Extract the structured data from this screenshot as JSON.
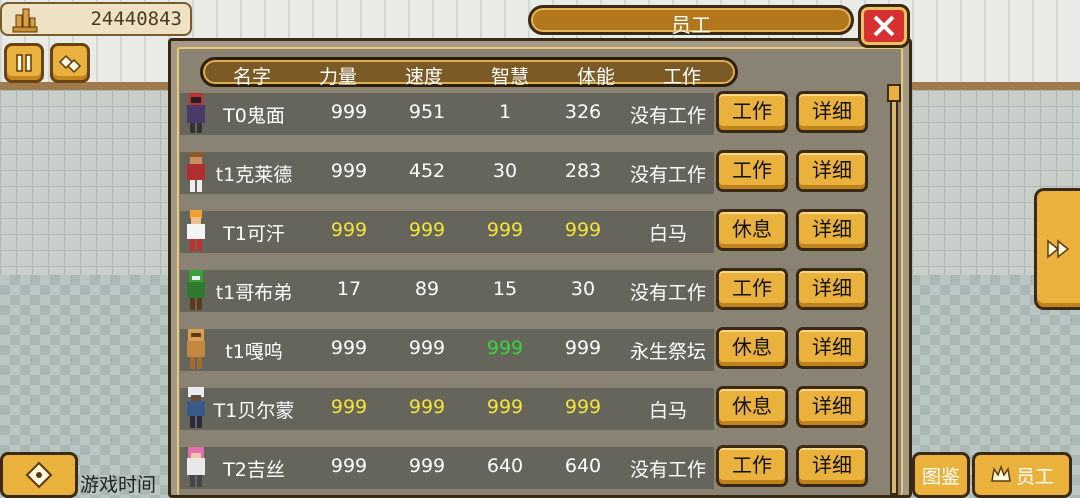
{
  "resource": {
    "amount": "24440843",
    "icon": "building-icon"
  },
  "top_buttons": [
    {
      "icon": "pause-icon"
    },
    {
      "icon": "gems-icon"
    }
  ],
  "panel": {
    "title": "员工",
    "close_icon": "close-icon"
  },
  "columns": [
    "名字",
    "力量",
    "速度",
    "智慧",
    "体能",
    "工作"
  ],
  "employees": [
    {
      "name": "T0鬼面",
      "str": "999",
      "spd": "951",
      "int": "1",
      "sta": "326",
      "job": "没有工作",
      "action": "工作",
      "detail": "详细"
    },
    {
      "name": "t1克莱德",
      "str": "999",
      "spd": "452",
      "int": "30",
      "sta": "283",
      "job": "没有工作",
      "action": "工作",
      "detail": "详细"
    },
    {
      "name": "T1可汗",
      "str": "999",
      "spd": "999",
      "int": "999",
      "sta": "999",
      "job": "白马",
      "action": "休息",
      "detail": "详细"
    },
    {
      "name": "t1哥布弟",
      "str": "17",
      "spd": "89",
      "int": "15",
      "sta": "30",
      "job": "没有工作",
      "action": "工作",
      "detail": "详细"
    },
    {
      "name": "t1嘎呜",
      "str": "999",
      "spd": "999",
      "int": "999",
      "sta": "999",
      "job": "永生祭坛",
      "action": "休息",
      "detail": "详细"
    },
    {
      "name": "T1贝尔蒙",
      "str": "999",
      "spd": "999",
      "int": "999",
      "sta": "999",
      "job": "白马",
      "action": "休息",
      "detail": "详细"
    },
    {
      "name": "T2吉丝",
      "str": "999",
      "spd": "999",
      "int": "640",
      "sta": "640",
      "job": "没有工作",
      "action": "工作",
      "detail": "详细"
    }
  ],
  "colors": {
    "max_stat": "#f4e43a",
    "green_stat": "#39d43a"
  },
  "bottom": {
    "game_time_label": "游戏时间",
    "tab_encyclopedia": "图鉴",
    "tab_staff": "员工",
    "next_icon": "double-arrow-right-icon"
  }
}
